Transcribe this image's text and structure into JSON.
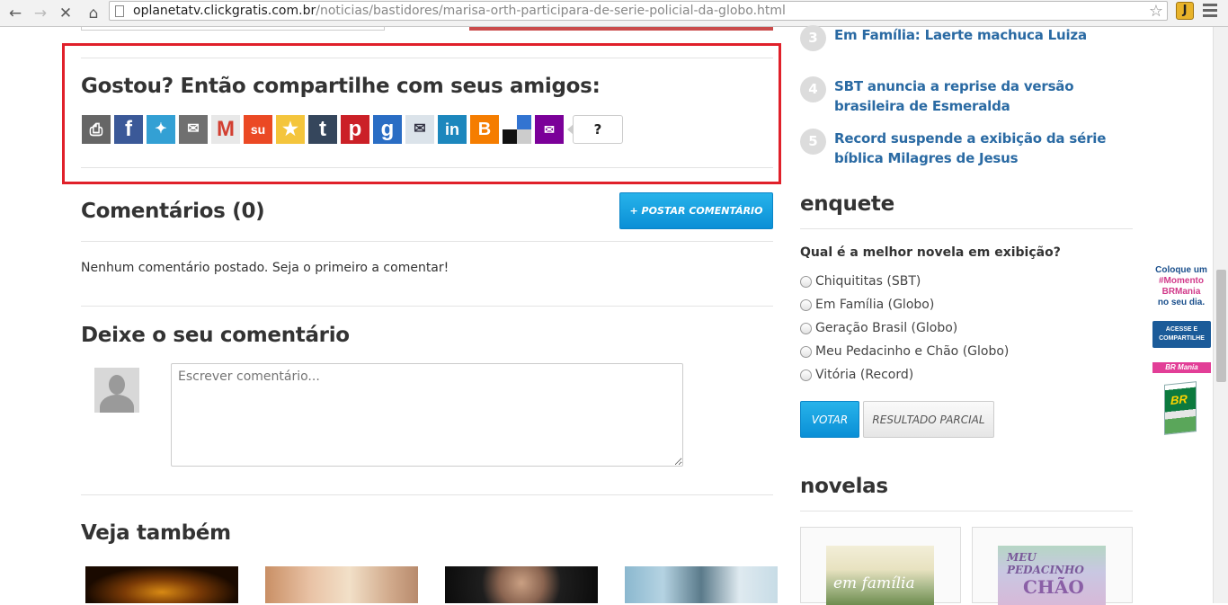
{
  "browser": {
    "url_host": "oplanetatv.clickgratis.com.br",
    "url_path": "/noticias/bastidores/marisa-orth-participara-de-serie-policial-da-globo.html",
    "extension_label": "J"
  },
  "share": {
    "title": "Gostou? Então compartilhe com seus amigos:",
    "count": "?",
    "icons": [
      {
        "name": "print-icon",
        "color": "#666666"
      },
      {
        "name": "facebook-icon",
        "color": "#3b5998"
      },
      {
        "name": "twitter-icon",
        "color": "#33a0d4"
      },
      {
        "name": "email-icon",
        "color": "#707070"
      },
      {
        "name": "gmail-icon",
        "color": "#e0e0e0"
      },
      {
        "name": "stumbleupon-icon",
        "color": "#eb4924"
      },
      {
        "name": "favorites-icon",
        "color": "#f4c53c"
      },
      {
        "name": "tumblr-icon",
        "color": "#35465c"
      },
      {
        "name": "pinterest-icon",
        "color": "#cb2027"
      },
      {
        "name": "google-icon",
        "color": "#2a6dc4"
      },
      {
        "name": "outlook-icon",
        "color": "#dbe3ea"
      },
      {
        "name": "linkedin-icon",
        "color": "#1c87bd"
      },
      {
        "name": "blogger-icon",
        "color": "#f57d00"
      },
      {
        "name": "delicious-icon",
        "color": "#3274d1"
      },
      {
        "name": "yahoo-mail-icon",
        "color": "#7b0099"
      }
    ]
  },
  "comments": {
    "title": "Comentários (0)",
    "post_button": "+ POSTAR COMENTÁRIO",
    "empty_text": "Nenhum comentário postado. Seja o primeiro a comentar!",
    "leave_title": "Deixe o seu comentário",
    "placeholder": "Escrever comentário..."
  },
  "see_also": {
    "title": "Veja também"
  },
  "ranking": [
    {
      "num": "3",
      "text": "Em Família: Laerte machuca Luiza"
    },
    {
      "num": "4",
      "text": "SBT anuncia a reprise da versão brasileira de Esmeralda"
    },
    {
      "num": "5",
      "text": "Record suspende a exibição da série bíblica Milagres de Jesus"
    }
  ],
  "poll": {
    "title": "enquete",
    "question": "Qual é a melhor novela em exibição?",
    "options": [
      "Chiquititas (SBT)",
      "Em Família (Globo)",
      "Geração Brasil (Globo)",
      "Meu Pedacinho e Chão (Globo)",
      "Vitória (Record)"
    ],
    "vote_button": "VOTAR",
    "result_button": "RESULTADO PARCIAL"
  },
  "novelas": {
    "title": "novelas",
    "items": [
      {
        "label": "em família"
      },
      {
        "label": "MEU PEDACINHO",
        "label2": "CHÃO"
      }
    ]
  },
  "ad": {
    "line1": "Coloque um",
    "line2": "#Momento",
    "line3": "BRMania",
    "line4": "no seu dia.",
    "button": "ACESSE E COMPARTILHE",
    "brand": "BR Mania",
    "logo": "BR"
  }
}
